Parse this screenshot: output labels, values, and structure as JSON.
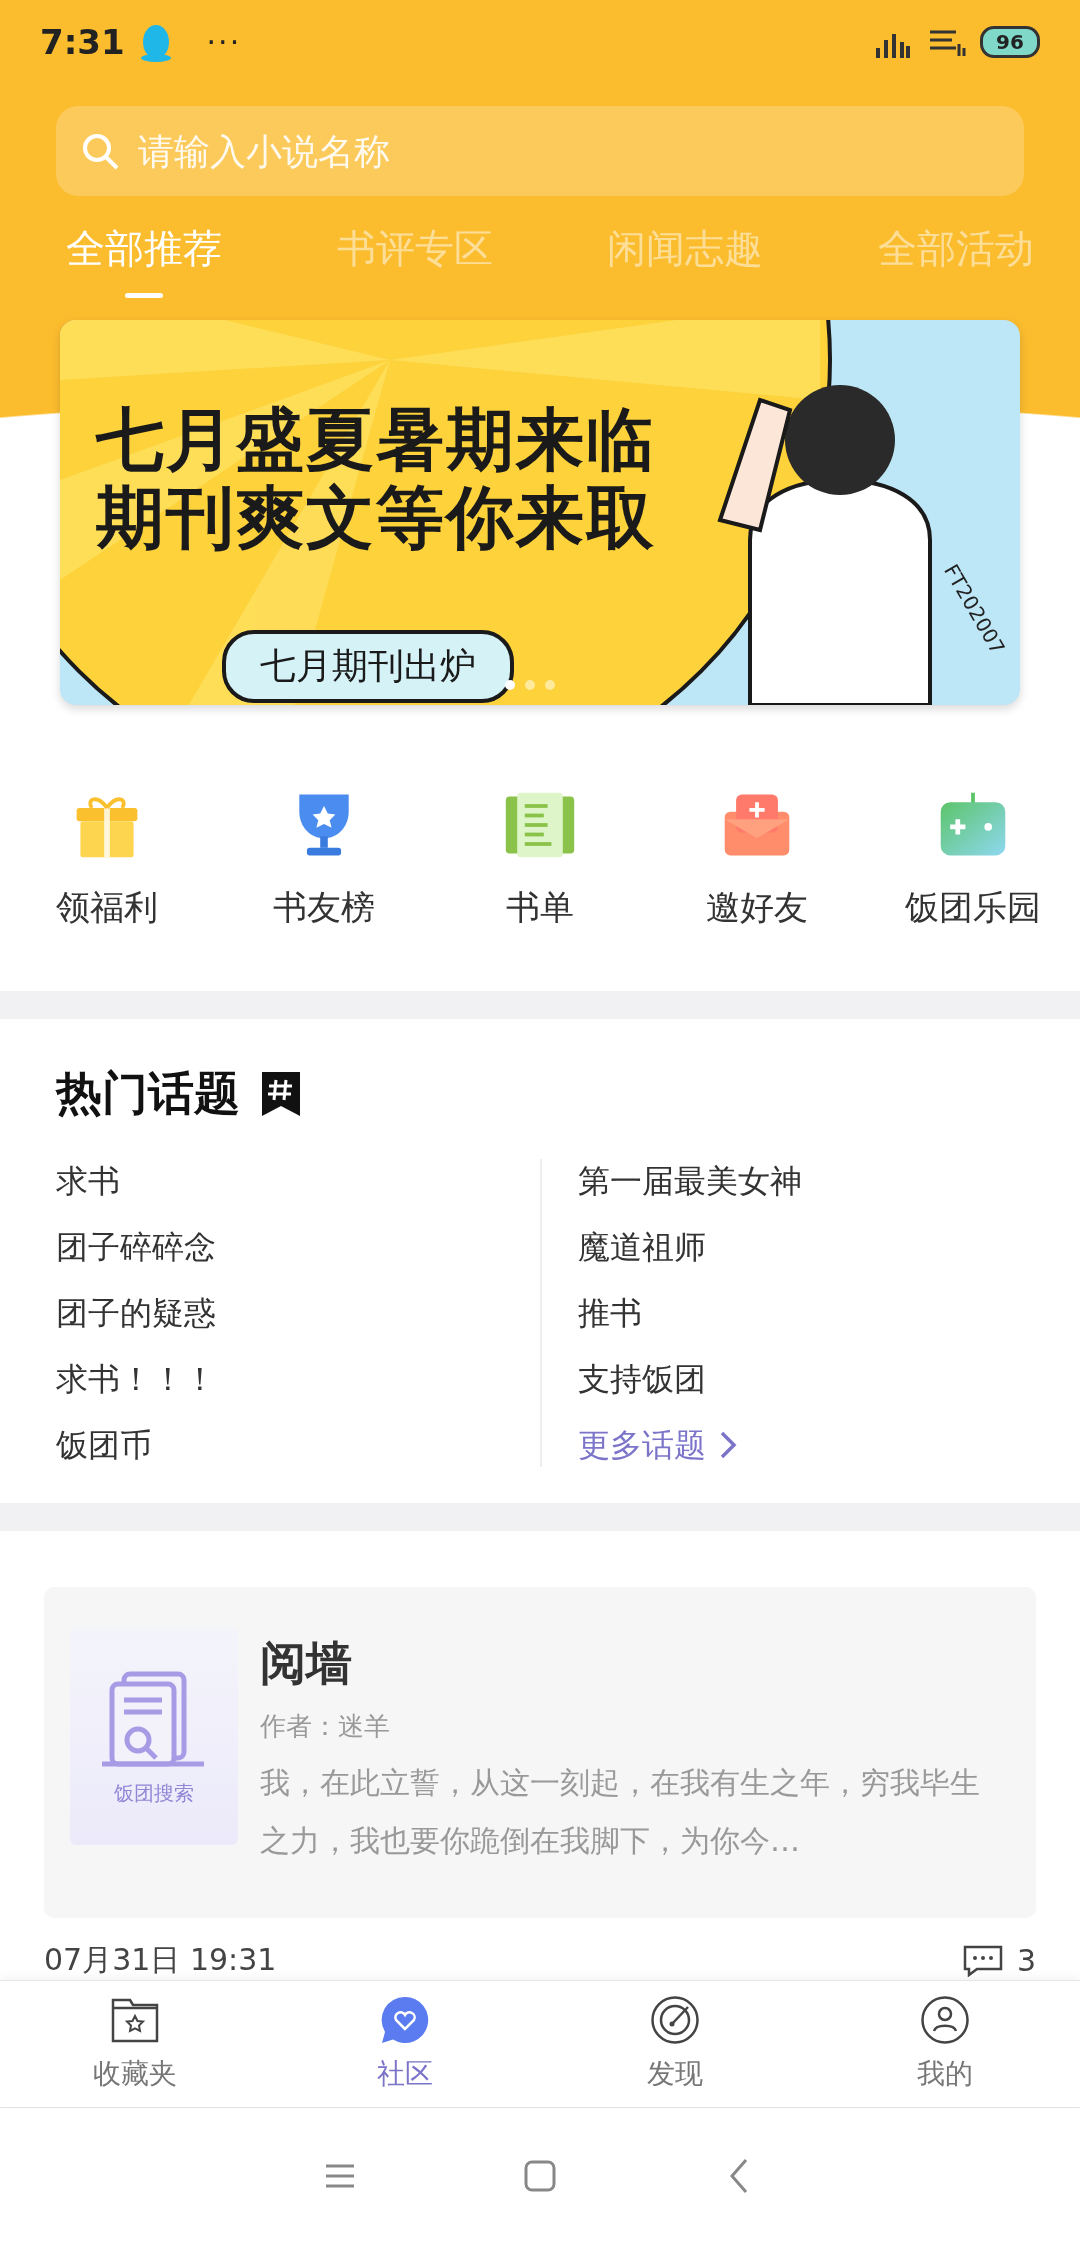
{
  "status_bar": {
    "time": "7:31",
    "more": "···",
    "battery": "96"
  },
  "search": {
    "placeholder": "请输入小说名称"
  },
  "tabs": [
    {
      "label": "全部推荐",
      "selected": true
    },
    {
      "label": "书评专区",
      "selected": false
    },
    {
      "label": "闲闻志趣",
      "selected": false
    },
    {
      "label": "全部活动",
      "selected": false
    }
  ],
  "banner": {
    "headline": [
      "七月盛夏暑期来临",
      "期刊爽文等你来取"
    ],
    "button": "七月期刊出炉",
    "tag": "FT202007",
    "dots": [
      {
        "selected": true
      },
      {
        "selected": false
      },
      {
        "selected": false
      }
    ]
  },
  "shortcuts": [
    {
      "label": "领福利",
      "kind": "gift"
    },
    {
      "label": "书友榜",
      "kind": "trophy"
    },
    {
      "label": "书单",
      "kind": "list"
    },
    {
      "label": "邀好友",
      "kind": "invite"
    },
    {
      "label": "饭团乐园",
      "kind": "game"
    }
  ],
  "hot_topics": {
    "title": "热门话题",
    "left": [
      "求书",
      "团子碎碎念",
      "团子的疑惑",
      "求书！！！",
      "饭团币"
    ],
    "right": [
      "第一届最美女神",
      "魔道祖师",
      "推书",
      "支持饭团"
    ],
    "more": "更多话题"
  },
  "post": {
    "cover_label": "饭团搜索",
    "title": "阅墙",
    "author": "作者：迷羊",
    "excerpt": "我，在此立誓，从这一刻起，在我有生之年，穷我毕生之力，我也要你跪倒在我脚下，为你今…",
    "date": "07月31日 19:31",
    "comments": "3"
  },
  "bottom_nav": [
    {
      "label": "收藏夹",
      "kind": "folder",
      "selected": false
    },
    {
      "label": "社区",
      "kind": "community",
      "selected": true
    },
    {
      "label": "发现",
      "kind": "discover",
      "selected": false
    },
    {
      "label": "我的",
      "kind": "profile",
      "selected": false
    }
  ]
}
